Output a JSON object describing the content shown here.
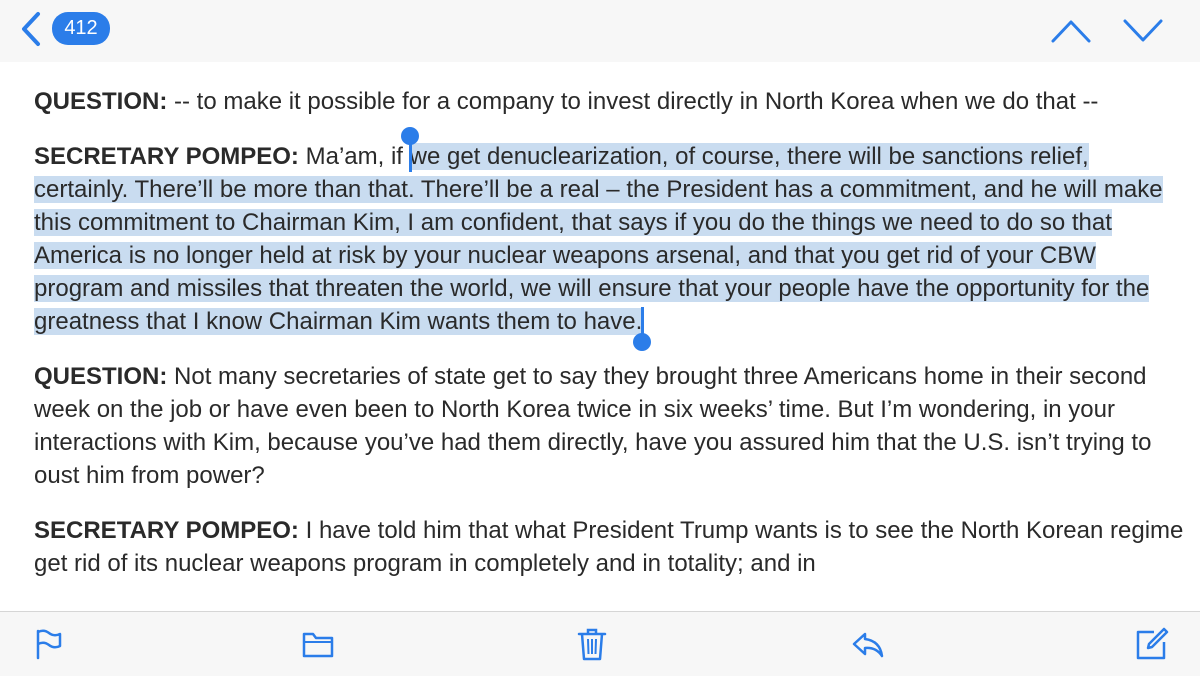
{
  "header": {
    "message_count": "412"
  },
  "transcript": [
    {
      "speaker": "QUESTION:",
      "text": " -- to make it possible for a company to invest directly in North Korea when we do that --"
    },
    {
      "speaker": "SECRETARY POMPEO:",
      "before": " Ma’am, if ",
      "selected": "we get denuclearization, of course, there will be sanctions relief, certainly. There’ll be more than that. There’ll be a real – the President has a commitment, and he will make this commitment to Chairman Kim, I am confident, that says if you do the things we need to do so that America is no longer held at risk by your nuclear weapons arsenal, and that you get rid of your CBW program and missiles that threaten the world, we will ensure that your people have the opportunity for the greatness that I know Chairman Kim wants them to have."
    },
    {
      "speaker": "QUESTION:",
      "text": " Not many secretaries of state get to say they brought three Americans home in their second week on the job or have even been to North Korea twice in six weeks’ time. But I’m wondering, in your interactions with Kim, because you’ve had them directly, have you assured him that the U.S. isn’t trying to oust him from power?"
    },
    {
      "speaker": "SECRETARY POMPEO:",
      "text": " I have told him that what President Trump wants is to see the North Korean regime get rid of its nuclear weapons program in completely and in totality; and in"
    }
  ],
  "colors": {
    "accent": "#2b7de9",
    "selection": "#c9dcf0",
    "bar_background": "#f7f7f7"
  },
  "toolbar_icons": [
    "flag-icon",
    "folder-icon",
    "trash-icon",
    "reply-icon",
    "compose-icon"
  ]
}
